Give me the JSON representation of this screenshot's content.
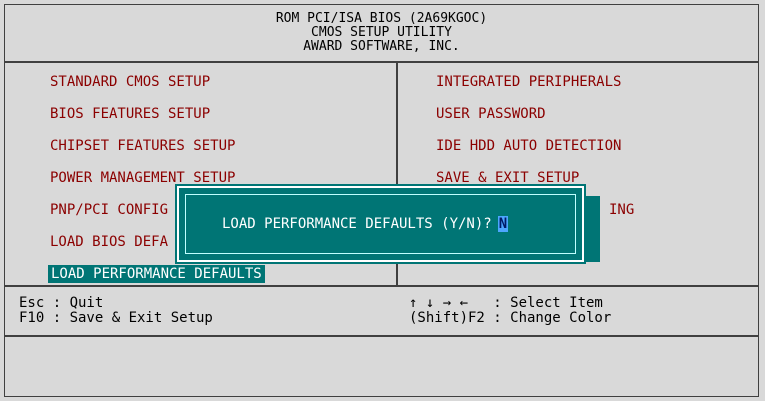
{
  "header": {
    "line1": "ROM PCI/ISA BIOS (2A69KGOC)",
    "line2": "CMOS SETUP UTILITY",
    "line3": "AWARD SOFTWARE, INC."
  },
  "menu": {
    "left": [
      "STANDARD CMOS SETUP",
      "BIOS FEATURES SETUP",
      "CHIPSET FEATURES SETUP",
      "POWER MANAGEMENT SETUP",
      "PNP/PCI CONFIG",
      "LOAD BIOS DEFA",
      "LOAD PERFORMANCE DEFAULTS"
    ],
    "right": [
      "INTEGRATED PERIPHERALS",
      "USER PASSWORD",
      "IDE HDD AUTO DETECTION",
      "SAVE & EXIT SETUP",
      "ING"
    ]
  },
  "help": {
    "esc": "Esc : Quit",
    "f10": "F10 : Save & Exit Setup",
    "arrows": "↑ ↓ → ←   : Select Item",
    "shift": "(Shift)F2 : Change Color"
  },
  "dialog": {
    "prompt": "LOAD PERFORMANCE DEFAULTS (Y/N)?",
    "value": "N"
  },
  "colors": {
    "background": "#d9d9d9",
    "menu_text": "#8b0000",
    "highlight": "#007575",
    "cursor": "#4da6ff"
  }
}
